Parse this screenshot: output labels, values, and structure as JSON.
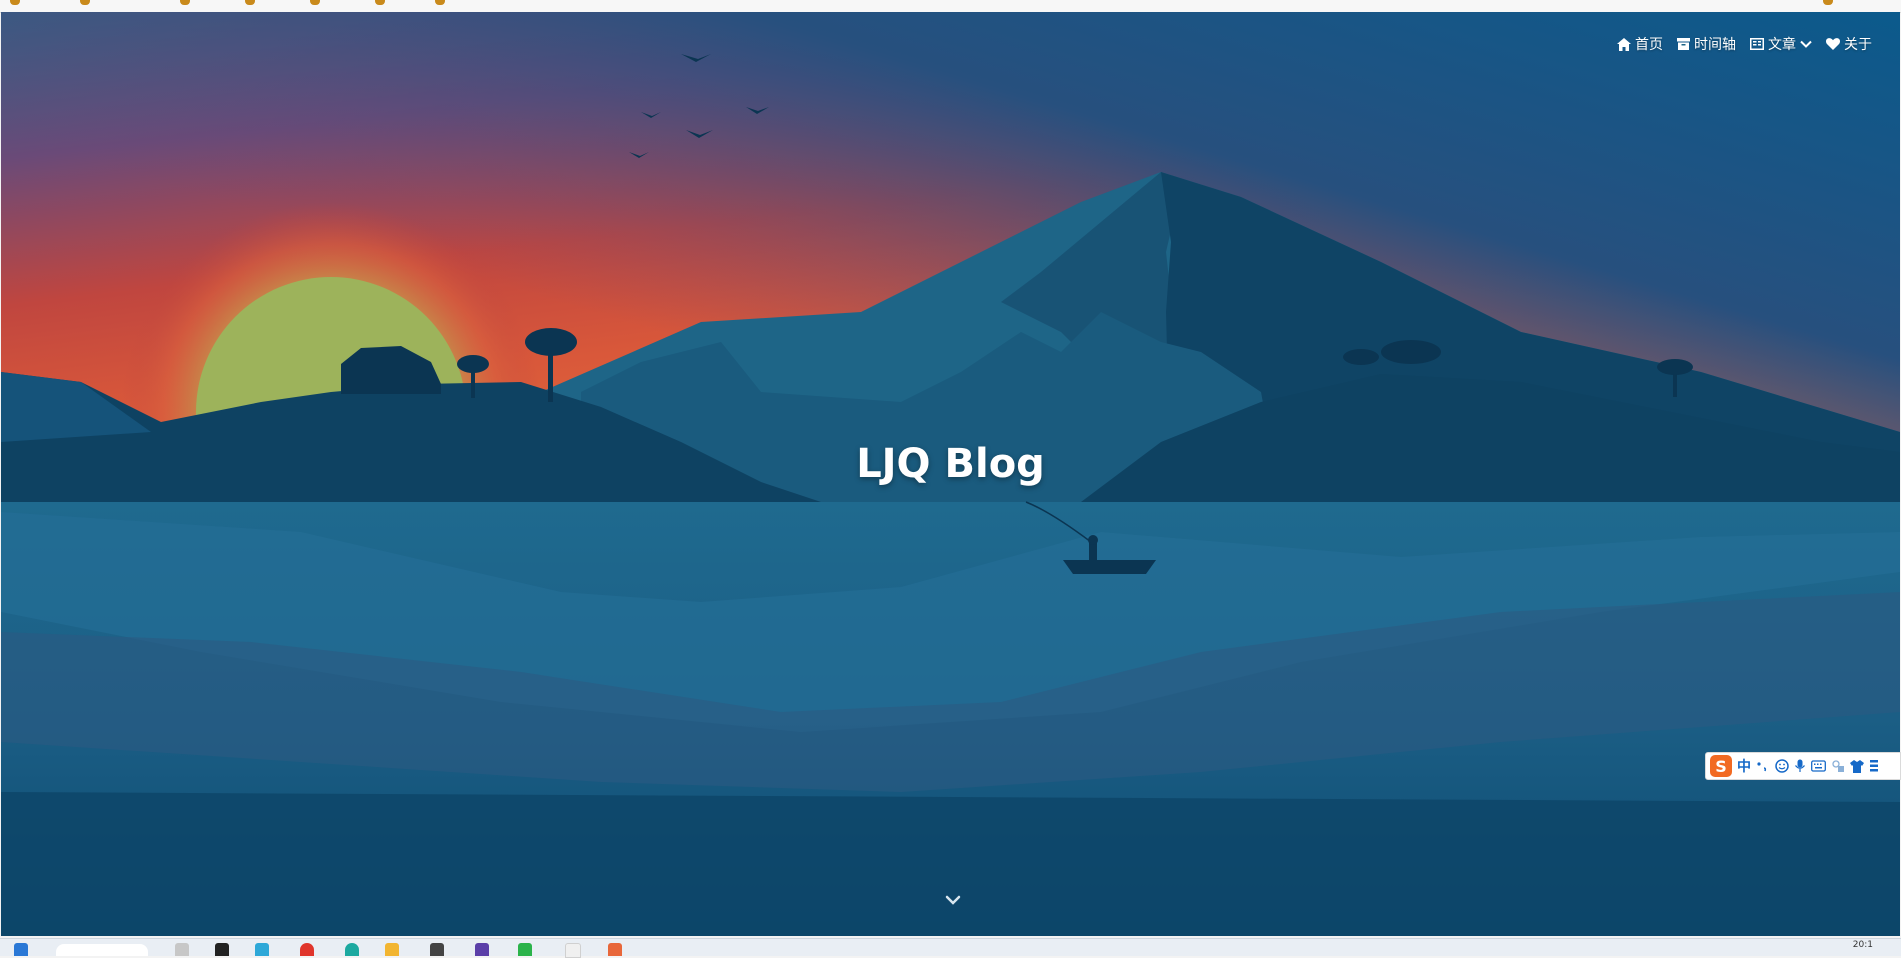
{
  "nav": {
    "items": [
      {
        "label": "首页",
        "icon": "home-icon"
      },
      {
        "label": "时间轴",
        "icon": "archive-icon"
      },
      {
        "label": "文章",
        "icon": "book-icon",
        "has_dropdown": true
      },
      {
        "label": "关于",
        "icon": "heart-icon"
      }
    ]
  },
  "hero": {
    "title": "LJQ Blog",
    "scroll_icon": "chevron-down-icon"
  },
  "ime": {
    "logo": "S",
    "mode": "中",
    "icons": [
      "punctuation-icon",
      "emoji-icon",
      "microphone-icon",
      "keyboard-icon",
      "toolbox-icon",
      "skin-icon",
      "menu-icon"
    ]
  },
  "taskbar": {
    "clock": "20:1"
  },
  "colors": {
    "sky_top": "#0b5a8c",
    "sunset_red": "#c0463f",
    "sun": "#9db35b",
    "mountain": "#1e6587",
    "water": "#1b5e85"
  }
}
